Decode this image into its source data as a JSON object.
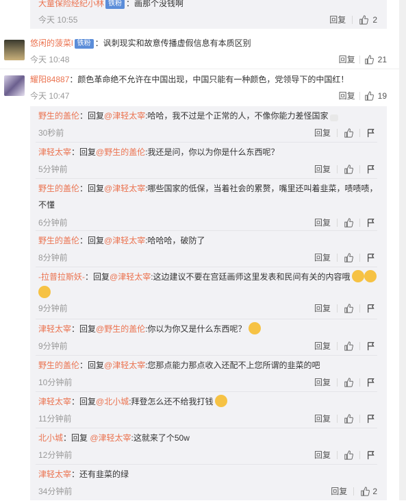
{
  "top_partial": {
    "author": "大童保险经纪小林",
    "badge": "铁粉",
    "text": "：画那个没钱啊",
    "time": "今天 10:55",
    "reply_label": "回复",
    "like_count": "2"
  },
  "comments": [
    {
      "author": "悠闲的菠菜l",
      "badge": "铁粉",
      "text": "：讽刺现实和故意传播虚假信息有本质区别",
      "time": "今天 10:48",
      "reply_label": "回复",
      "like_count": "21"
    },
    {
      "author": "耀阳84887",
      "text": "：颜色革命绝不允许在中国出现，中国只能有一种颜色，党领导下的中国红！",
      "time": "今天 10:47",
      "reply_label": "回复",
      "like_count": "19"
    }
  ],
  "replies": [
    {
      "author": "野生的盖伦",
      "prefix": "：回复",
      "mention": "@津轻太宰",
      "text": ":哈哈，我不过是个正常的人，不像你能力差怪国家",
      "emoji": "heart-broken-icon",
      "time": "30秒前",
      "reply_label": "回复"
    },
    {
      "author": "津轻太宰",
      "prefix": "：回复",
      "mention": "@野生的盖伦",
      "text": ":我还是问，你以为你是什么东西呢？",
      "time": "5分钟前",
      "reply_label": "回复"
    },
    {
      "author": "野生的盖伦",
      "prefix": "：回复",
      "mention": "@津轻太宰",
      "text": ":哪些国家的低保，当着社会的累赘，嘴里还叫着韭菜，啧啧啧，",
      "text2": "不懂",
      "time": "6分钟前",
      "reply_label": "回复"
    },
    {
      "author": "野生的盖伦",
      "prefix": "：回复",
      "mention": "@津轻太宰",
      "text": ":哈哈哈，破防了",
      "time": "8分钟前",
      "reply_label": "回复"
    },
    {
      "author": "-拉普拉斯妖-",
      "prefix": "：回复",
      "mention": "@津轻太宰",
      "text": ":这边建议不要在宫廷画师这里发表和民间有关的内容哦",
      "time": "9分钟前",
      "reply_label": "回复"
    },
    {
      "author": "津轻太宰",
      "prefix": "：回复",
      "mention": "@野生的盖伦",
      "text": ":你以为你又是什么东西呢？",
      "time": "9分钟前",
      "reply_label": "回复"
    },
    {
      "author": "野生的盖伦",
      "prefix": "：回复",
      "mention": "@津轻太宰",
      "text": ":您那点能力那点收入还配不上您所谓的韭菜的吧",
      "time": "10分钟前",
      "reply_label": "回复"
    },
    {
      "author": "津轻太宰",
      "prefix": "：回复",
      "mention": "@北小城",
      "text": ":拜登怎么还不给我打钱",
      "time": "11分钟前",
      "reply_label": "回复"
    },
    {
      "author": "北小城",
      "prefix": "：回复 ",
      "mention": "@津轻太宰",
      "text": ":这就来了个50w",
      "time": "12分钟前",
      "reply_label": "回复"
    },
    {
      "author": "津轻太宰",
      "prefix": "",
      "mention": "",
      "text": "：还有韭菜的绿",
      "time": "34分钟前",
      "reply_label": "回复",
      "like_count": "2"
    }
  ],
  "report_label": "举报",
  "colors": {
    "link": "#eb7350",
    "badge": "#5b8dd9",
    "reply_bg": "#f2f2f5"
  }
}
